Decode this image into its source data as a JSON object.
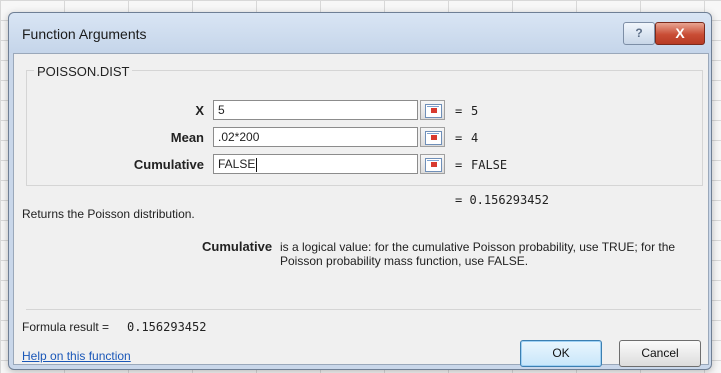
{
  "dialog": {
    "title": "Function Arguments",
    "help_glyph": "?",
    "close_glyph": "X"
  },
  "function": {
    "name": "POISSON.DIST",
    "arguments": [
      {
        "label": "X",
        "input": "5",
        "eq": "=",
        "value": "5"
      },
      {
        "label": "Mean",
        "input": ".02*200",
        "eq": "=",
        "value": "4"
      },
      {
        "label": "Cumulative",
        "input": "FALSE",
        "eq": "=",
        "value": "FALSE"
      }
    ],
    "overall_result": "= 0.156293452",
    "description": "Returns the Poisson distribution.",
    "arg_help_label": "Cumulative",
    "arg_help_text_line1": "is a logical value: for the cumulative Poisson probability, use TRUE; for the",
    "arg_help_text_line2": "Poisson probability mass function, use FALSE."
  },
  "footer": {
    "formula_result_label": "Formula result =",
    "formula_result_value": "0.156293452",
    "help_link": "Help on this function",
    "ok_label": "OK",
    "cancel_label": "Cancel"
  },
  "icons": {
    "ref_button": "collapse-dialog-icon"
  }
}
